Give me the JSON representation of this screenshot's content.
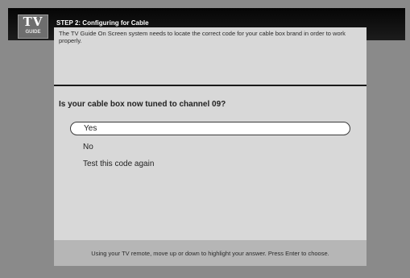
{
  "header": {
    "logo_text": "TV",
    "logo_subtext": "GUIDE",
    "step_title": "STEP 2: Configuring for Cable"
  },
  "intro_text": "The TV Guide On Screen system needs to locate the correct code for your cable box brand in order to work properly.",
  "question": "Is your cable box now tuned to channel 09?",
  "options": [
    {
      "label": "Yes",
      "selected": true
    },
    {
      "label": "No",
      "selected": false
    },
    {
      "label": "Test this code again",
      "selected": false
    }
  ],
  "footer_hint": "Using your TV remote, move up or down to highlight your answer. Press Enter to choose."
}
